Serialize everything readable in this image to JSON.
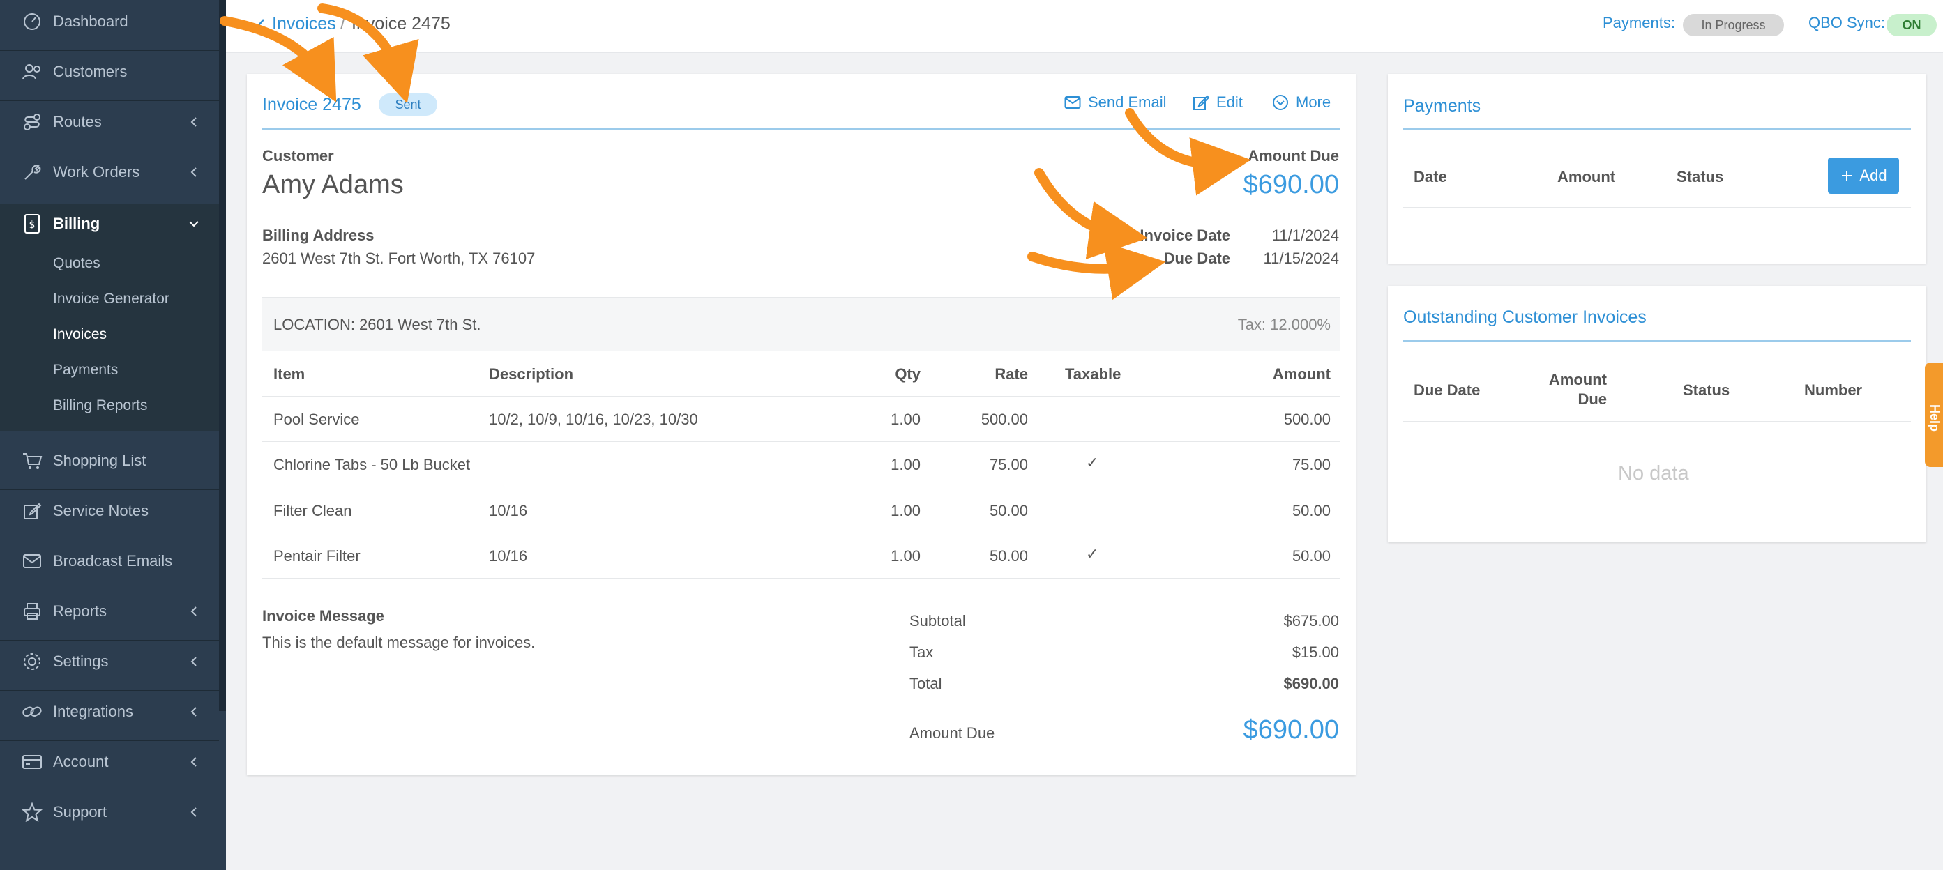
{
  "sidebar": {
    "items": [
      {
        "label": "Dashboard",
        "icon": "dashboard-icon"
      },
      {
        "label": "Customers",
        "icon": "customers-icon"
      },
      {
        "label": "Routes",
        "icon": "routes-icon"
      },
      {
        "label": "Work Orders",
        "icon": "wrench-icon"
      },
      {
        "label": "Billing",
        "icon": "billing-icon"
      },
      {
        "label": "Shopping List",
        "icon": "cart-icon"
      },
      {
        "label": "Service Notes",
        "icon": "edit-icon"
      },
      {
        "label": "Broadcast Emails",
        "icon": "mail-icon"
      },
      {
        "label": "Reports",
        "icon": "printer-icon"
      },
      {
        "label": "Settings",
        "icon": "gear-icon"
      },
      {
        "label": "Integrations",
        "icon": "link-icon"
      },
      {
        "label": "Account",
        "icon": "card-icon"
      },
      {
        "label": "Support",
        "icon": "star-icon"
      }
    ],
    "billing_sub": [
      "Quotes",
      "Invoice Generator",
      "Invoices",
      "Payments",
      "Billing Reports"
    ]
  },
  "topbar": {
    "back_label": "Invoices",
    "separator": "/",
    "current": "Invoice 2475",
    "payments_label": "Payments:",
    "payments_status": "In Progress",
    "qbo_label": "QBO Sync:",
    "qbo_status": "ON"
  },
  "invoice": {
    "title": "Invoice 2475",
    "status": "Sent",
    "actions": {
      "send_email": "Send Email",
      "edit": "Edit",
      "more": "More"
    },
    "customer_label": "Customer",
    "customer_name": "Amy Adams",
    "billing_address_label": "Billing Address",
    "billing_address": "2601 West 7th St. Fort Worth, TX 76107",
    "amount_due_label": "Amount Due",
    "amount_due": "$690.00",
    "invoice_date_label": "Invoice Date",
    "invoice_date": "11/1/2024",
    "due_date_label": "Due Date",
    "due_date": "11/15/2024",
    "location": "LOCATION: 2601 West 7th St.",
    "tax_rate": "Tax: 12.000%",
    "columns": {
      "item": "Item",
      "description": "Description",
      "qty": "Qty",
      "rate": "Rate",
      "taxable": "Taxable",
      "amount": "Amount"
    },
    "lines": [
      {
        "item": "Pool Service",
        "description": "10/2, 10/9, 10/16, 10/23, 10/30",
        "qty": "1.00",
        "rate": "500.00",
        "taxable": "",
        "amount": "500.00"
      },
      {
        "item": "Chlorine Tabs - 50 Lb Bucket",
        "description": "",
        "qty": "1.00",
        "rate": "75.00",
        "taxable": "✓",
        "amount": "75.00"
      },
      {
        "item": "Filter Clean",
        "description": "10/16",
        "qty": "1.00",
        "rate": "50.00",
        "taxable": "",
        "amount": "50.00"
      },
      {
        "item": "Pentair Filter",
        "description": "10/16",
        "qty": "1.00",
        "rate": "50.00",
        "taxable": "✓",
        "amount": "50.00"
      }
    ],
    "message_label": "Invoice Message",
    "message": "This is the default message for invoices.",
    "subtotal_label": "Subtotal",
    "subtotal": "$675.00",
    "tax_label": "Tax",
    "tax": "$15.00",
    "total_label": "Total",
    "total": "$690.00",
    "footer_due_label": "Amount Due",
    "footer_due": "$690.00"
  },
  "payments_card": {
    "title": "Payments",
    "columns": [
      "Date",
      "Amount",
      "Status"
    ],
    "add_label": "Add"
  },
  "outstanding_card": {
    "title": "Outstanding Customer Invoices",
    "columns": {
      "due_date": "Due Date",
      "amount_1": "Amount",
      "amount_2": "Due",
      "status": "Status",
      "number": "Number"
    },
    "empty": "No data"
  },
  "help": "Help",
  "colors": {
    "sidebar": "#2c3d4f",
    "accent": "#2d8fd5",
    "annotation": "#f7901e"
  }
}
